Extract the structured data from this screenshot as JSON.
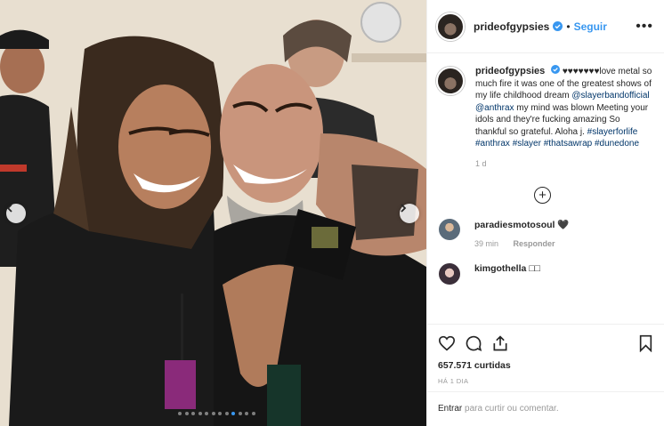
{
  "post": {
    "username": "prideofgypsies",
    "follow_label": "Seguir",
    "separator": "•",
    "more_label": "•••",
    "caption": {
      "username": "prideofgypsies",
      "hearts": "♥♥♥♥♥♥♥",
      "text_1": "love metal so much fire it was one of the greatest shows of my life childhood dream ",
      "mention_1": "@slayerbandofficial",
      "mention_2": "@anthrax",
      "text_2": " my mind was blown Meeting your idols and they're fucking amazing So thankful so grateful. Aloha j. ",
      "tags": [
        "#slayerforlife",
        "#anthrax",
        "#slayer",
        "#thatsawrap",
        "#dunedone"
      ],
      "ago": "1 d"
    },
    "load_more": "+",
    "comments": [
      {
        "username": "paradiesmotosoul",
        "text": "🖤",
        "time": "39 min",
        "reply": "Responder",
        "avatar_color": "#5a6b7a"
      },
      {
        "username": "kimgothella",
        "text": "□□",
        "avatar_color": "#3b2f3a"
      }
    ],
    "likes": "657.571 curtidas",
    "date": "HÁ 1 DIA",
    "login_link": "Entrar",
    "login_text": " para curtir ou comentar."
  },
  "carousel": {
    "slides": 12,
    "active_index": 8
  },
  "colors": {
    "accent": "#3897f0",
    "hashtag": "#003569",
    "muted": "#999999"
  }
}
